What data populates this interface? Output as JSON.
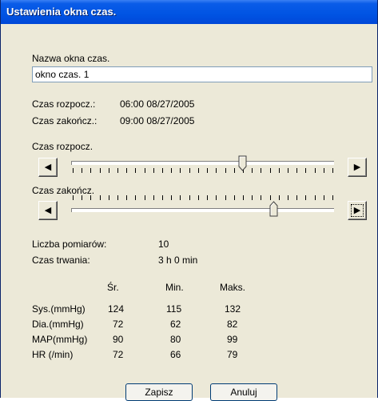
{
  "window": {
    "title": "Ustawienia okna czas."
  },
  "name_field": {
    "label": "Nazwa okna czas.",
    "value": "okno czas. 1"
  },
  "times": {
    "start_label": "Czas rozpocz.:",
    "start_value": "06:00 08/27/2005",
    "end_label": "Czas zakończ.:",
    "end_value": "09:00 08/27/2005"
  },
  "sliders": {
    "start": {
      "label": "Czas rozpocz.",
      "level": 0.65
    },
    "end": {
      "label": "Czas zakończ.",
      "level": 0.77
    },
    "tick_count": 30
  },
  "summary": {
    "count_label": "Liczba pomiarów:",
    "count_value": "10",
    "duration_label": "Czas trwania:",
    "duration_value": "3 h 0 min"
  },
  "stats": {
    "headers": [
      "Śr.",
      "Min.",
      "Maks."
    ],
    "rows": [
      {
        "label": "Sys.(mmHg)",
        "values": [
          "124",
          "115",
          "132"
        ]
      },
      {
        "label": "Dia.(mmHg)",
        "values": [
          "72",
          "62",
          "82"
        ]
      },
      {
        "label": "MAP(mmHg)",
        "values": [
          "90",
          "80",
          "99"
        ]
      },
      {
        "label": "HR (/min)",
        "values": [
          "72",
          "66",
          "79"
        ]
      }
    ]
  },
  "buttons": {
    "save": "Zapisz",
    "cancel": "Anuluj"
  },
  "colors": {
    "title_bar": "#0054e3",
    "window_bg": "#ece9d8"
  }
}
